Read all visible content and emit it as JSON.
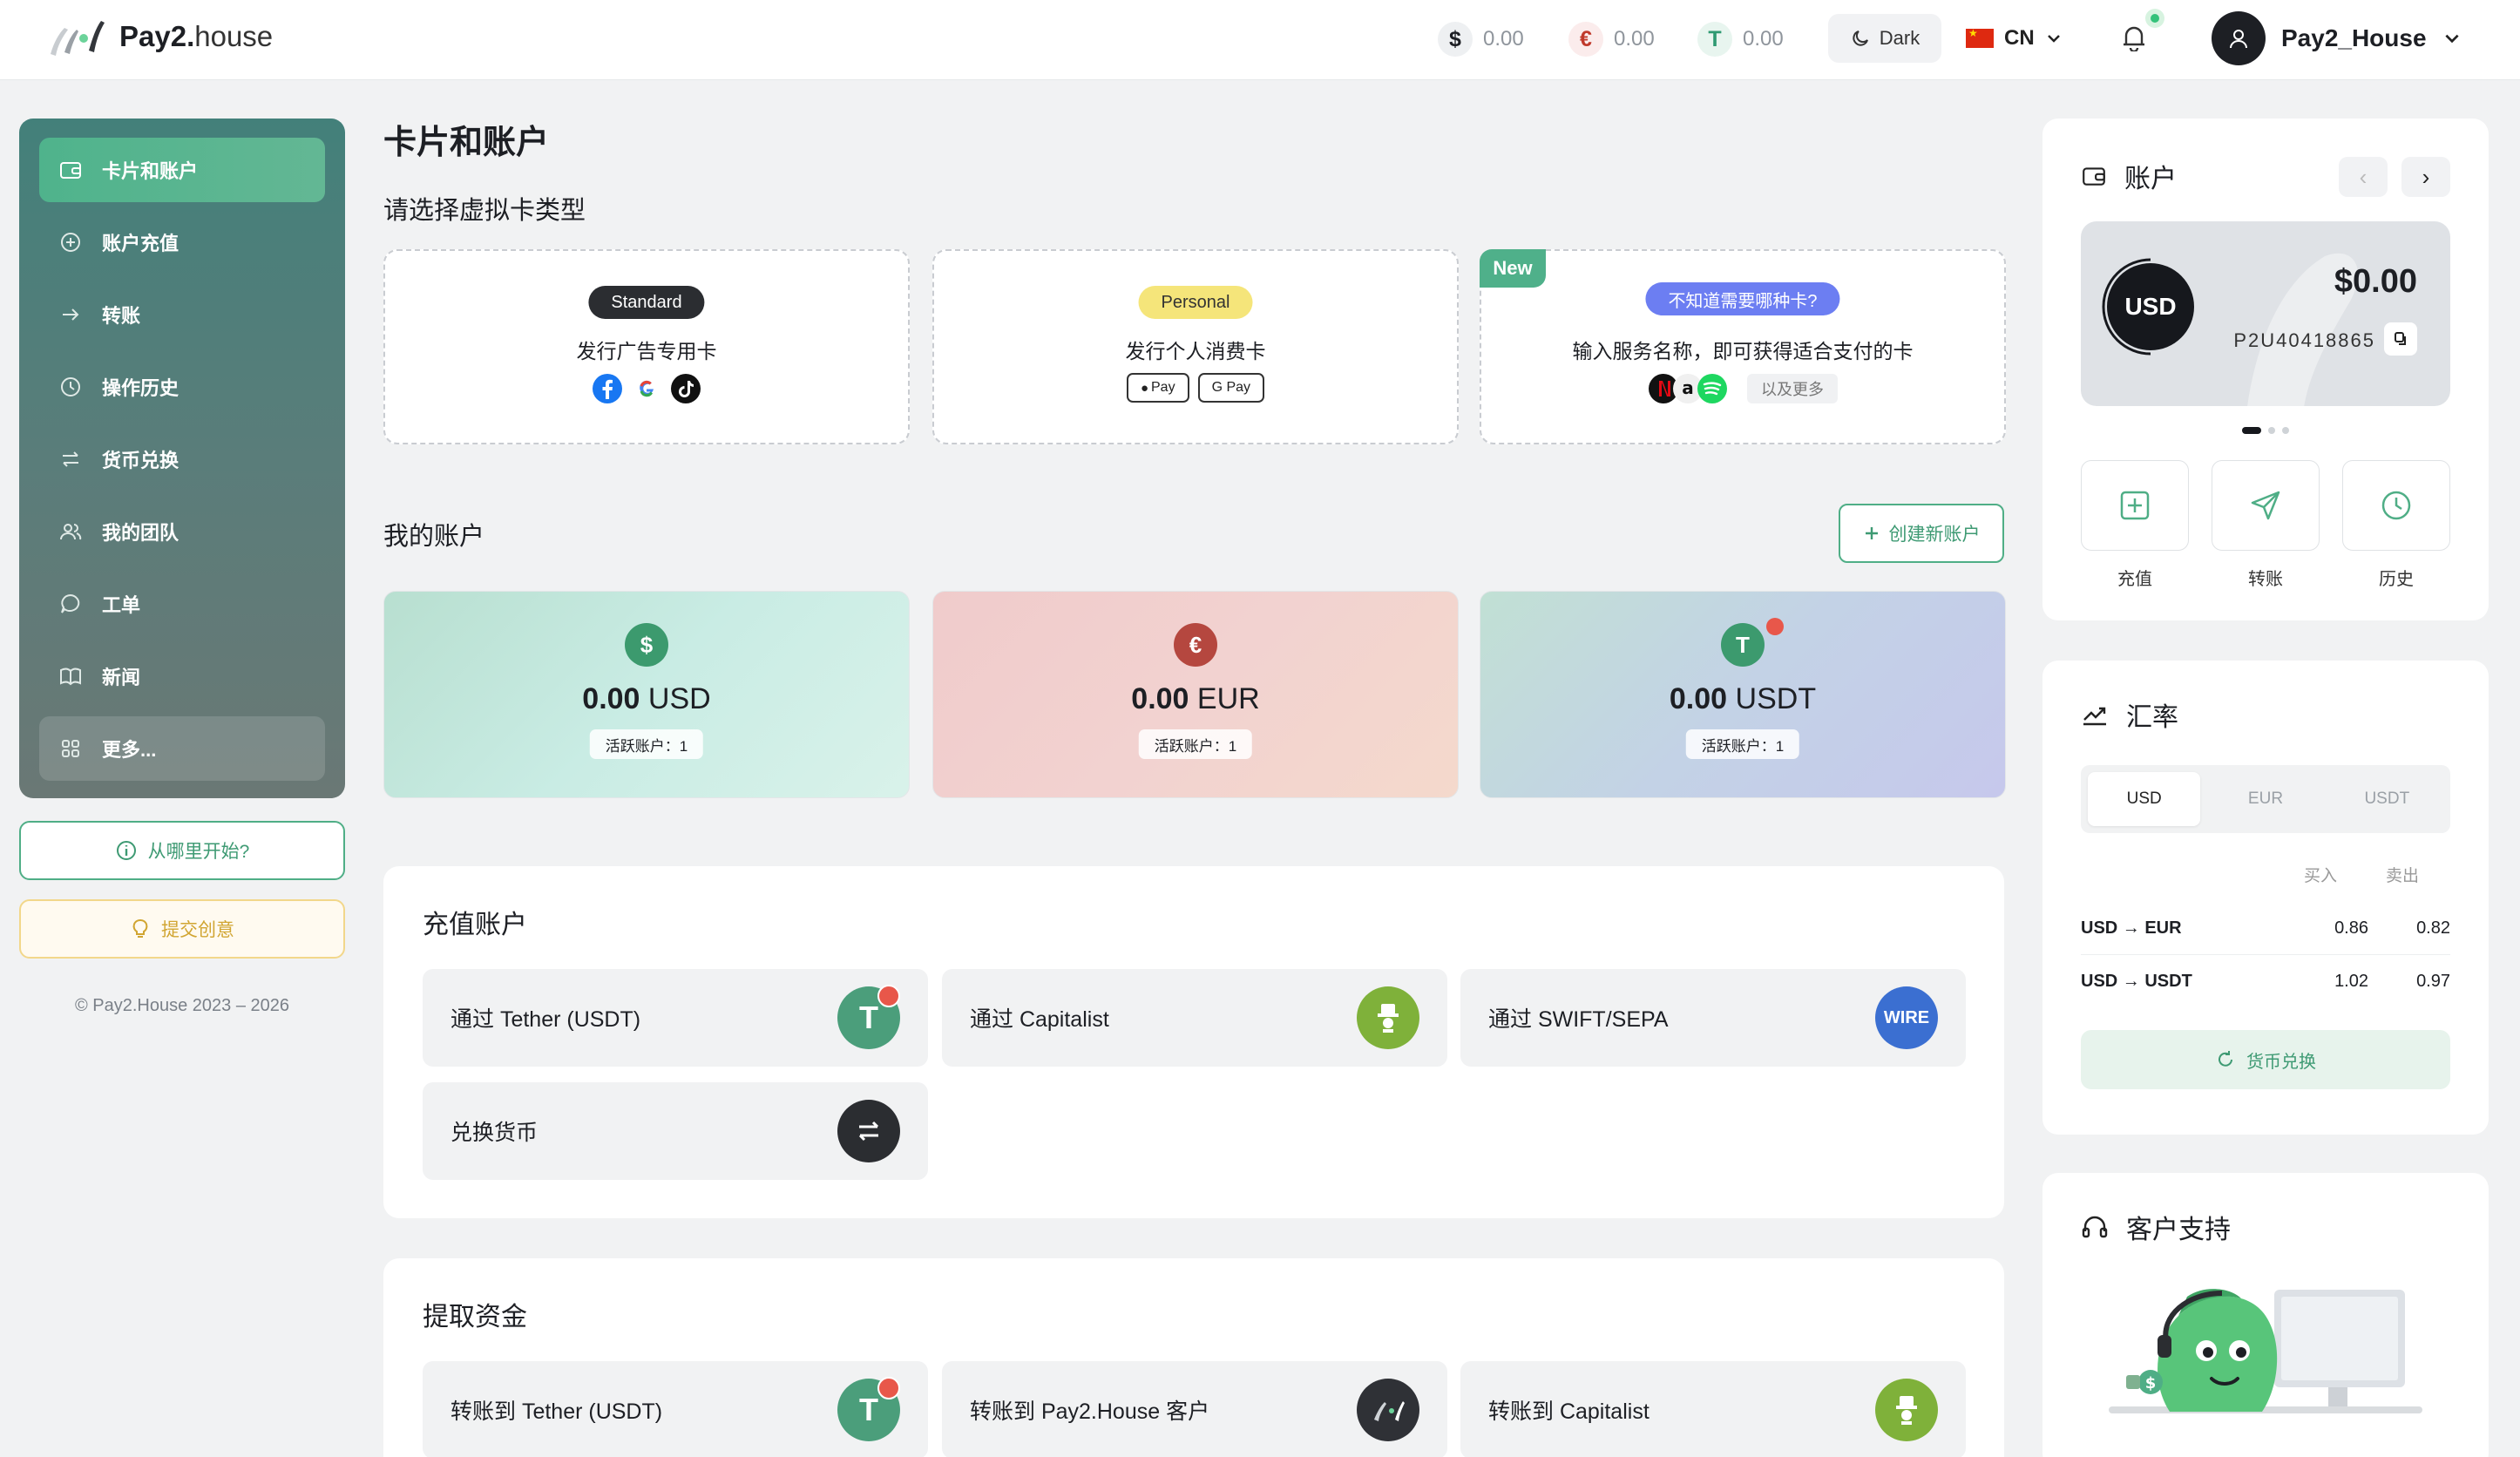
{
  "header": {
    "brand_bold": "Pay2.",
    "brand_light": "house",
    "balances": [
      {
        "symbol": "$",
        "value": "0.00",
        "color": "#1d1f24",
        "bg": "#eef0f2"
      },
      {
        "symbol": "€",
        "value": "0.00",
        "color": "#c0392b",
        "bg": "#fbecec"
      },
      {
        "symbol": "T",
        "value": "0.00",
        "color": "#2e9a72",
        "bg": "#e8f5ef"
      }
    ],
    "theme_label": "Dark",
    "language": "CN",
    "username": "Pay2_House"
  },
  "sidebar": {
    "items": [
      {
        "label": "卡片和账户",
        "icon": "wallet-icon"
      },
      {
        "label": "账户充值",
        "icon": "plus-circle-icon"
      },
      {
        "label": "转账",
        "icon": "arrow-right-icon"
      },
      {
        "label": "操作历史",
        "icon": "clock-icon"
      },
      {
        "label": "货币兑换",
        "icon": "swap-icon"
      },
      {
        "label": "我的团队",
        "icon": "team-icon"
      },
      {
        "label": "工单",
        "icon": "chat-icon"
      },
      {
        "label": "新闻",
        "icon": "book-icon"
      },
      {
        "label": "更多...",
        "icon": "grid-icon"
      }
    ],
    "start_label": "从哪里开始?",
    "idea_label": "提交创意",
    "copyright": "© Pay2.House 2023 – 2026"
  },
  "main": {
    "title": "卡片和账户",
    "card_types_heading": "请选择虚拟卡类型",
    "card_types": [
      {
        "pill": "Standard",
        "desc": "发行广告专用卡"
      },
      {
        "pill": "Personal",
        "desc": "发行个人消费卡",
        "chips": [
          "Pay",
          "G Pay"
        ]
      },
      {
        "tag": "New",
        "pill": "不知道需要哪种卡?",
        "desc": "输入服务名称，即可获得适合支付的卡",
        "more": "以及更多"
      }
    ],
    "accounts_heading": "我的账户",
    "create_label": "创建新账户",
    "accounts": [
      {
        "symbol": "$",
        "amount": "0.00",
        "currency": "USD",
        "badge": "活跃账户：1",
        "color": "#3c9a6e"
      },
      {
        "symbol": "€",
        "amount": "0.00",
        "currency": "EUR",
        "badge": "活跃账户：1",
        "color": "#b5473f"
      },
      {
        "symbol": "T",
        "amount": "0.00",
        "currency": "USDT",
        "badge": "活跃账户：1",
        "color": "#3c9a6e"
      }
    ],
    "topup": {
      "title": "充值账户",
      "options": [
        {
          "label": "通过 Tether (USDT)",
          "icon": "tether-icon"
        },
        {
          "label": "通过 Capitalist",
          "icon": "capitalist-icon"
        },
        {
          "label": "通过 SWIFT/SEPA",
          "icon": "wire-icon",
          "icon_text": "WIRE"
        },
        {
          "label": "兑换货币",
          "icon": "exchange-icon"
        }
      ]
    },
    "withdraw": {
      "title": "提取资金",
      "options": [
        {
          "label": "转账到 Tether (USDT)",
          "icon": "tether-icon"
        },
        {
          "label": "转账到 Pay2.House 客户",
          "icon": "pay2house-icon"
        },
        {
          "label": "转账到 Capitalist",
          "icon": "capitalist-icon"
        }
      ]
    }
  },
  "right": {
    "account": {
      "title": "账户",
      "currency": "USD",
      "amount": "$0.00",
      "account_id": "P2U40418865",
      "actions": [
        "充值",
        "转账",
        "历史"
      ]
    },
    "rates": {
      "title": "汇率",
      "tabs": [
        "USD",
        "EUR",
        "USDT"
      ],
      "active_tab": "USD",
      "buy_label": "买入",
      "sell_label": "卖出",
      "rows": [
        {
          "pair": "USD → EUR",
          "buy": "0.86",
          "sell": "0.82"
        },
        {
          "pair": "USD → USDT",
          "buy": "1.02",
          "sell": "0.97"
        }
      ],
      "exchange_label": "货币兑换"
    },
    "support": {
      "title": "客户支持"
    }
  }
}
